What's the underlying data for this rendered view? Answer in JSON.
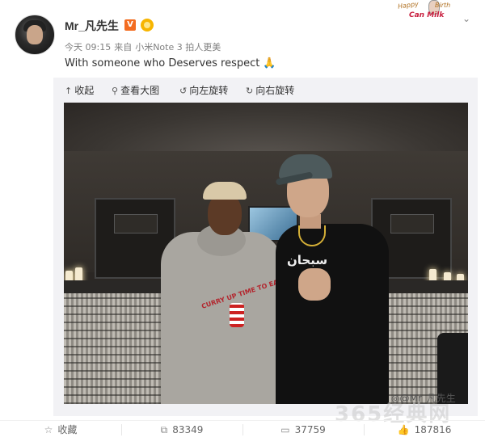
{
  "post": {
    "username": "Mr_凡先生",
    "verified_badge": "V",
    "time": "今天 09:15",
    "source_prefix": "来自",
    "device": "小米Note 3 拍人更美",
    "text": "With someone who Deserves respect",
    "emoji_icon": "pray-icon"
  },
  "header_sticker": {
    "word1": "Happy",
    "word2": "Birth",
    "word3": "Can Milk"
  },
  "media_toolbar": {
    "collapse": "收起",
    "view_large": "查看大图",
    "rotate_left": "向左旋转",
    "rotate_right": "向右旋转"
  },
  "photo": {
    "hoodie_print": "CURRY UP TIME TO EAT",
    "tee_print": "سبحان"
  },
  "watermark": {
    "weibo_handle": "@Mr_凡先生",
    "site": "365经典网"
  },
  "actions": {
    "favorite": "收藏",
    "repost_count": "83349",
    "comment_count": "37759",
    "like_count": "187816"
  },
  "colors": {
    "accent_orange": "#f36c21",
    "text_gray": "#808080",
    "media_bg": "#f2f2f5"
  }
}
